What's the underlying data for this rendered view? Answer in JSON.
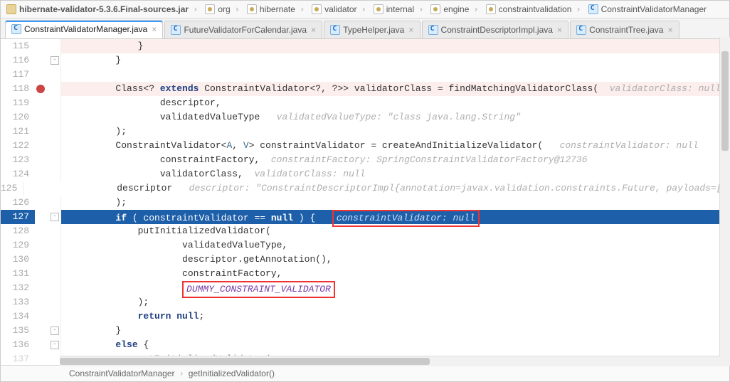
{
  "breadcrumbs": [
    {
      "icon": "jar",
      "label": "hibernate-validator-5.3.6.Final-sources.jar"
    },
    {
      "icon": "pkg",
      "label": "org"
    },
    {
      "icon": "pkg",
      "label": "hibernate"
    },
    {
      "icon": "pkg",
      "label": "validator"
    },
    {
      "icon": "pkg",
      "label": "internal"
    },
    {
      "icon": "pkg",
      "label": "engine"
    },
    {
      "icon": "pkg",
      "label": "constraintvalidation"
    },
    {
      "icon": "cls",
      "label": "ConstraintValidatorManager"
    }
  ],
  "tabs": [
    {
      "label": "ConstraintValidatorManager.java",
      "active": true
    },
    {
      "label": "FutureValidatorForCalendar.java",
      "active": false
    },
    {
      "label": "TypeHelper.java",
      "active": false
    },
    {
      "label": "ConstraintDescriptorImpl.java",
      "active": false
    },
    {
      "label": "ConstraintTree.java",
      "active": false
    }
  ],
  "status": {
    "class": "ConstraintValidatorManager",
    "method": "getInitializedValidator()"
  },
  "code": {
    "l115": {
      "num": "115",
      "ind": "            ",
      "p1": "}"
    },
    "l116": {
      "num": "116",
      "ind": "        ",
      "p1": "}"
    },
    "l117": {
      "num": "117"
    },
    "l118": {
      "num": "118",
      "ind": "        ",
      "p1": "Class<? ",
      "kw": "extends",
      "p2": " ConstraintValidator<?, ?>> validatorClass = findMatchingValidatorClass(  ",
      "hint": "validatorClass: null"
    },
    "l119": {
      "num": "119",
      "ind": "                ",
      "p1": "descriptor,"
    },
    "l120": {
      "num": "120",
      "ind": "                ",
      "p1": "validatedValueType   ",
      "hint": "validatedValueType: \"class java.lang.String\""
    },
    "l121": {
      "num": "121",
      "ind": "        ",
      "p1": ");"
    },
    "l122": {
      "num": "122",
      "ind": "        ",
      "p1": "ConstraintValidator<",
      "t1": "A",
      "p2": ", ",
      "t2": "V",
      "p3": "> constraintValidator = createAndInitializeValidator(   ",
      "hint": "constraintValidator: null"
    },
    "l123": {
      "num": "123",
      "ind": "                ",
      "p1": "constraintFactory,  ",
      "hint": "constraintFactory: SpringConstraintValidatorFactory@12736"
    },
    "l124": {
      "num": "124",
      "ind": "                ",
      "p1": "validatorClass,  ",
      "hint": "validatorClass: null"
    },
    "l125": {
      "num": "125",
      "ind": "                ",
      "p1": "descriptor   ",
      "hint": "descriptor: \"ConstraintDescriptorImpl{annotation=javax.validation.constraints.Future, payloads=[], hasCompo"
    },
    "l126": {
      "num": "126",
      "ind": "        ",
      "p1": ");"
    },
    "l127": {
      "num": "127",
      "ind": "        ",
      "kw": "if",
      "p1": " ( constraintValidator == ",
      "kw2": "null",
      "p2": " ) {   ",
      "hint": "constraintValidator: null"
    },
    "l128": {
      "num": "128",
      "ind": "            ",
      "p1": "putInitializedValidator("
    },
    "l129": {
      "num": "129",
      "ind": "                    ",
      "p1": "validatedValueType,"
    },
    "l130": {
      "num": "130",
      "ind": "                    ",
      "p1": "descriptor.getAnnotation(),"
    },
    "l131": {
      "num": "131",
      "ind": "                    ",
      "p1": "constraintFactory,"
    },
    "l132": {
      "num": "132",
      "ind": "                    ",
      "cst": "DUMMY_CONSTRAINT_VALIDATOR"
    },
    "l133": {
      "num": "133",
      "ind": "            ",
      "p1": ");"
    },
    "l134": {
      "num": "134",
      "ind": "            ",
      "kw": "return null",
      "p1": ";"
    },
    "l135": {
      "num": "135",
      "ind": "        ",
      "p1": "}"
    },
    "l136": {
      "num": "136",
      "ind": "        ",
      "kw": "else",
      "p1": " {"
    },
    "l137": {
      "num": "137",
      "ind": "            ",
      "p1": "putInitializedValidator("
    }
  }
}
